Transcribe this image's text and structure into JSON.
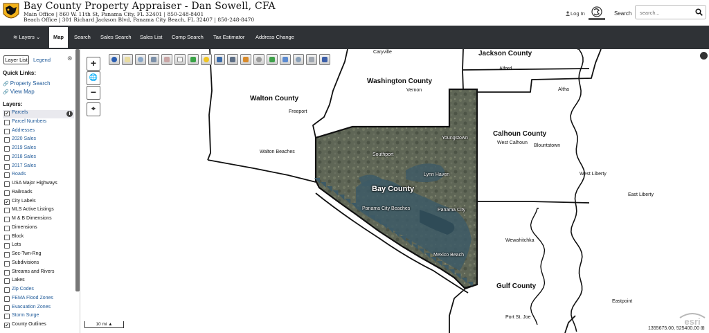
{
  "header": {
    "title": "Bay County Property Appraiser - Dan Sowell, CFA",
    "main_office": "Main Office | 860 W. 11th St, Panama City, FL 32401 | 850-248-8401",
    "beach_office": "Beach Office | 301 Richard Jackson Blvd, Panama City Beach, FL 32407 | 850-248-8470",
    "login_label": "Log In",
    "search_label": "Search",
    "search_placeholder": "search..."
  },
  "nav": {
    "items": [
      {
        "label": "Layers"
      },
      {
        "label": "Map"
      },
      {
        "label": "Search"
      },
      {
        "label": "Sales Search"
      },
      {
        "label": "Sales List"
      },
      {
        "label": "Comp Search"
      },
      {
        "label": "Tax Estimator"
      },
      {
        "label": "Address Change"
      }
    ]
  },
  "sidebar": {
    "tabs": {
      "layer_list": "Layer List",
      "legend": "Legend"
    },
    "close_glyph": "⊗",
    "quick_links_title": "Quick Links:",
    "quick_links": [
      "Property Search",
      "View Map"
    ],
    "layers_title": "Layers:",
    "layers": [
      {
        "label": "Parcels",
        "checked": true,
        "link": true
      },
      {
        "label": "Parcel Numbers",
        "checked": false,
        "link": true
      },
      {
        "label": "Addresses",
        "checked": false,
        "link": true
      },
      {
        "label": "2020 Sales",
        "checked": false,
        "link": true
      },
      {
        "label": "2019 Sales",
        "checked": false,
        "link": true
      },
      {
        "label": "2018 Sales",
        "checked": false,
        "link": true
      },
      {
        "label": "2017 Sales",
        "checked": false,
        "link": true
      },
      {
        "label": "Roads",
        "checked": false,
        "link": true
      },
      {
        "label": "USA Major Highways",
        "checked": false,
        "link": false
      },
      {
        "label": "Railroads",
        "checked": false,
        "link": false
      },
      {
        "label": "City Labels",
        "checked": true,
        "link": false
      },
      {
        "label": "MLS Active Listings",
        "checked": false,
        "link": false
      },
      {
        "label": "M & B Dimensions",
        "checked": false,
        "link": false
      },
      {
        "label": "Dimensions",
        "checked": false,
        "link": false
      },
      {
        "label": "Block",
        "checked": false,
        "link": false
      },
      {
        "label": "Lots",
        "checked": false,
        "link": false
      },
      {
        "label": "Sec-Twn-Rng",
        "checked": false,
        "link": false
      },
      {
        "label": "Subdivisions",
        "checked": false,
        "link": false
      },
      {
        "label": "Streams and Rivers",
        "checked": false,
        "link": false
      },
      {
        "label": "Lakes",
        "checked": false,
        "link": false
      },
      {
        "label": "Zip Codes",
        "checked": false,
        "link": true
      },
      {
        "label": "FEMA Flood Zones",
        "checked": false,
        "link": true
      },
      {
        "label": "Evacuation Zones",
        "checked": false,
        "link": true
      },
      {
        "label": "Storm Surge",
        "checked": false,
        "link": true
      },
      {
        "label": "County Outlines",
        "checked": true,
        "link": false
      }
    ]
  },
  "map": {
    "zoom_in": "+",
    "zoom_out": "−",
    "scale_label": "10 mi",
    "coordinates": "1355675.00, 525400.00",
    "esri_label": "esri",
    "counties": {
      "jackson": "Jackson County",
      "washington": "Washington County",
      "walton": "Walton County",
      "calhoun": "Calhoun County",
      "bay": "Bay County",
      "gulf": "Gulf County"
    },
    "cities": {
      "caryville": "Caryville",
      "alford": "Alford",
      "vernon": "Vernon",
      "freeport": "Freeport",
      "altha": "Altha",
      "walton_beaches": "Walton Beaches",
      "youngstown": "Youngstown",
      "west_calhoun": "West Calhoun",
      "blountstown": "Blountstown",
      "southport": "Southport",
      "lynn_haven": "Lynn Haven",
      "west_liberty": "West Liberty",
      "east_liberty": "East Liberty",
      "panama_city_beaches": "Panama City Beaches",
      "panama_city": "Panama City",
      "wewahitchka": "Wewahitchka",
      "mexico_beach": "Mexico Beach",
      "eastpoint": "Eastpoint",
      "port_st_joe": "Port St. Joe"
    },
    "colors": {
      "nav_bg": "#2f3236",
      "link": "#1f5a99",
      "photo": "#5f6656",
      "water": "#3d5a66"
    }
  }
}
